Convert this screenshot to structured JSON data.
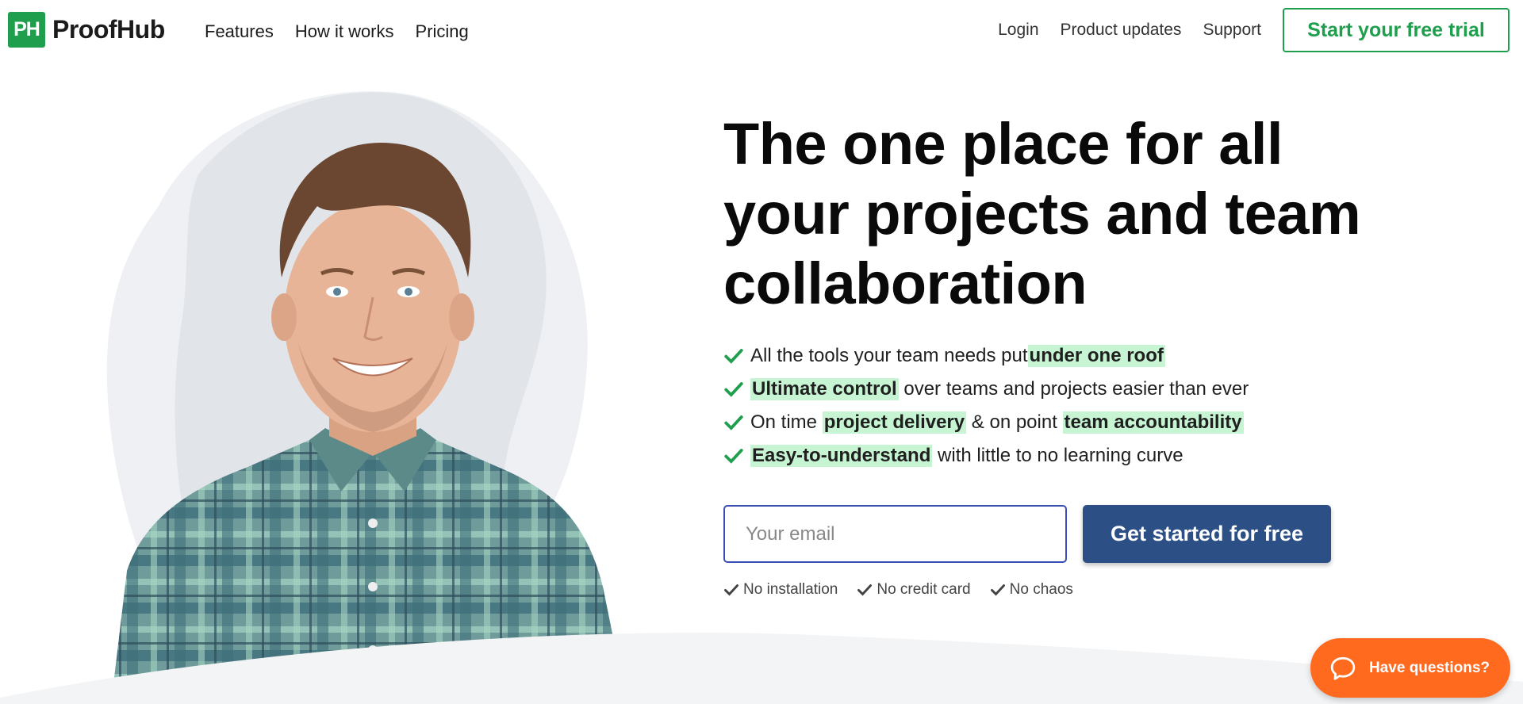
{
  "header": {
    "logo_mark": "PH",
    "logo_text": "ProofHub",
    "nav_left": [
      "Features",
      "How it works",
      "Pricing"
    ],
    "nav_right": [
      "Login",
      "Product updates",
      "Support"
    ],
    "trial_button": "Start your free trial"
  },
  "hero": {
    "headline": "The one place for all your projects and team collaboration",
    "features": [
      {
        "pre": "All the tools your team needs put ",
        "hl": "under one roof",
        "post": ""
      },
      {
        "pre": "",
        "hl": "Ultimate control",
        "post": " over teams and projects easier than ever"
      },
      {
        "pre": "On time ",
        "hl": "project delivery",
        "mid": " & on point ",
        "hl2": "team accountability"
      },
      {
        "pre": "",
        "hl": "Easy-to-understand",
        "post": " with little to no learning curve"
      }
    ],
    "email_placeholder": "Your email",
    "cta_button": "Get started for free",
    "badges": [
      "No installation",
      "No credit card",
      "No chaos"
    ]
  },
  "chat": {
    "label": "Have questions?"
  },
  "colors": {
    "brand_green": "#1f9f4e",
    "cta_blue": "#2c4f85",
    "highlight": "#c7f5d3",
    "chat_orange": "#ff6a1f"
  },
  "icons": [
    "check-icon",
    "chat-bubble-icon"
  ]
}
